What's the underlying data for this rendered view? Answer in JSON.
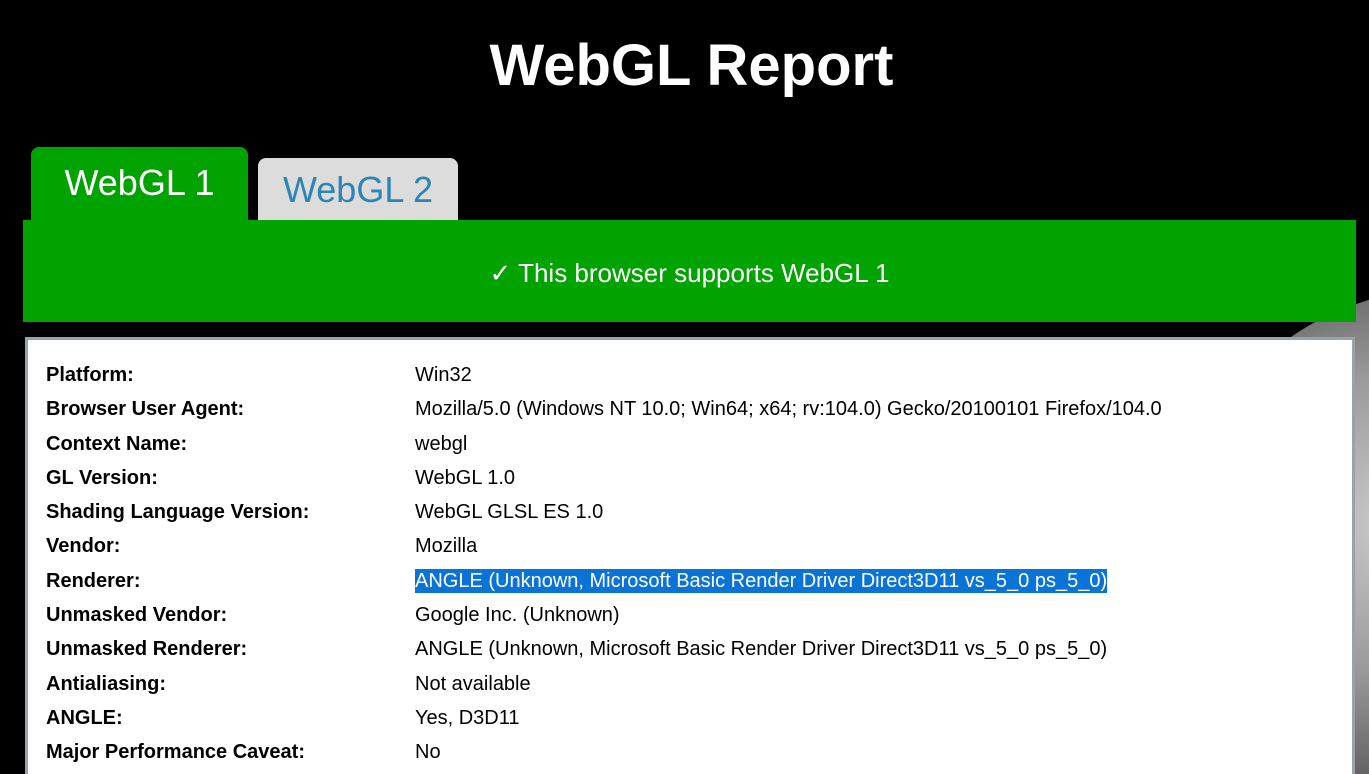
{
  "page": {
    "title": "WebGL Report"
  },
  "tabs": [
    {
      "label": "WebGL 1",
      "active": true
    },
    {
      "label": "WebGL 2",
      "active": false
    }
  ],
  "banner": {
    "text": "✓ This browser supports WebGL 1",
    "color": "#00a300"
  },
  "report": {
    "rows": [
      {
        "label": "Platform:",
        "value": "Win32"
      },
      {
        "label": "Browser User Agent:",
        "value": "Mozilla/5.0 (Windows NT 10.0; Win64; x64; rv:104.0) Gecko/20100101 Firefox/104.0"
      },
      {
        "label": "Context Name:",
        "value": "webgl"
      },
      {
        "label": "GL Version:",
        "value": "WebGL 1.0"
      },
      {
        "label": "Shading Language Version:",
        "value": "WebGL GLSL ES 1.0"
      },
      {
        "label": "Vendor:",
        "value": "Mozilla"
      },
      {
        "label": "Renderer:",
        "value": "ANGLE (Unknown, Microsoft Basic Render Driver Direct3D11 vs_5_0 ps_5_0)",
        "selected": true
      },
      {
        "label": "Unmasked Vendor:",
        "value": "Google Inc. (Unknown)"
      },
      {
        "label": "Unmasked Renderer:",
        "value": "ANGLE (Unknown, Microsoft Basic Render Driver Direct3D11 vs_5_0 ps_5_0)"
      },
      {
        "label": "Antialiasing:",
        "value": "Not available"
      },
      {
        "label": "ANGLE:",
        "value": "Yes, D3D11"
      },
      {
        "label": "Major Performance Caveat:",
        "value": "No"
      }
    ]
  },
  "colors": {
    "background": "#000000",
    "active_tab": "#00a300",
    "inactive_tab": "#dcdcdc",
    "inactive_tab_text": "#2b86b4",
    "selection": "#0a74d6"
  }
}
